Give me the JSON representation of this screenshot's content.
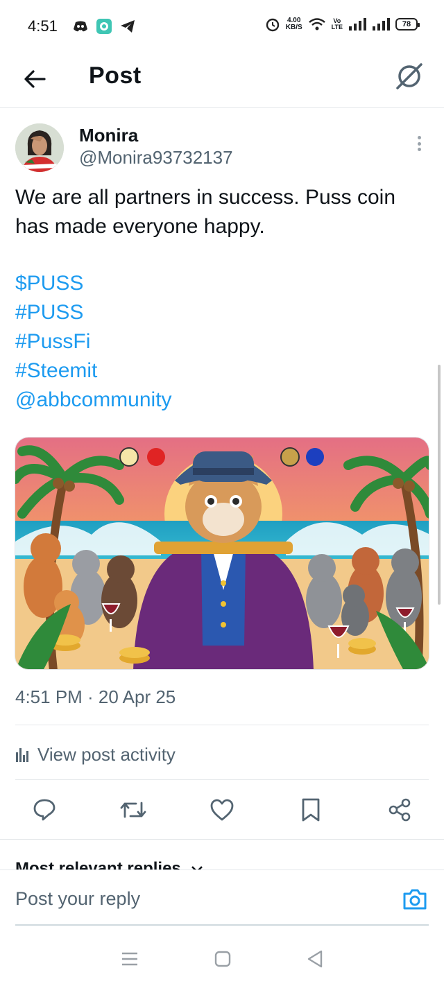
{
  "status_bar": {
    "time": "4:51",
    "net_speed_value": "4.00",
    "net_speed_unit": "KB/S",
    "volte_top": "Vo",
    "volte_bottom": "LTE",
    "battery": "78"
  },
  "header": {
    "title": "Post"
  },
  "post": {
    "author_name": "Monira",
    "author_handle": "@Monira93732137",
    "text_line1": "We are all partners in success. Puss coin",
    "text_line2": "has made everyone happy.",
    "tags": [
      "$PUSS",
      "#PUSS",
      "#PussFi",
      "#Steemit",
      "@abbcommunity"
    ],
    "timestamp": "4:51 PM · 20 Apr 25",
    "activity_label": "View post activity"
  },
  "replies": {
    "sort_label": "Most relevant replies"
  },
  "reply_bar": {
    "placeholder": "Post your reply"
  },
  "colors": {
    "link": "#1d9bf0",
    "secondary_text": "#536471",
    "accent": "#1d9bf0"
  }
}
